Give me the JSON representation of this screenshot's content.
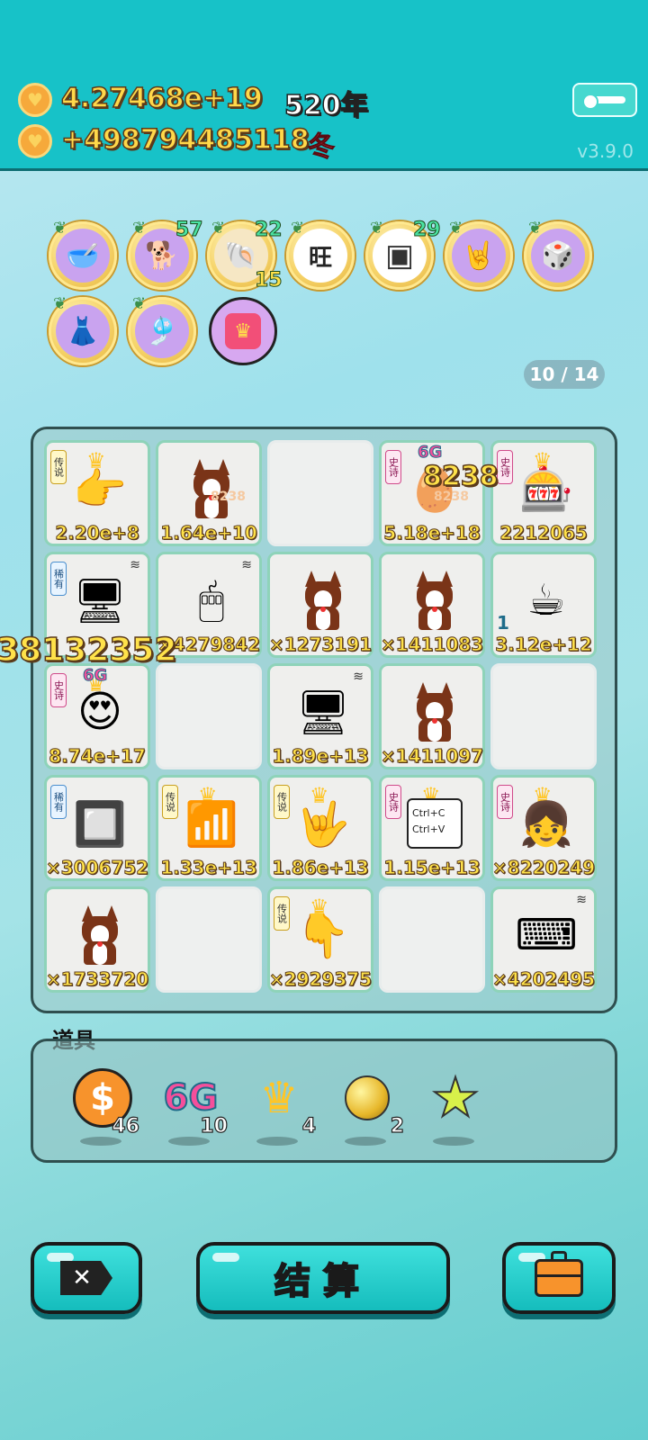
{
  "header": {
    "total_money": "4.27468e+19",
    "income_rate": "+498794485118",
    "year": "520年",
    "season": "冬",
    "version": "v3.9.0"
  },
  "badges": [
    {
      "name": "food-bowl",
      "glyph": "🥣",
      "count": ""
    },
    {
      "name": "shiba-dog",
      "glyph": "🐕",
      "count": "57"
    },
    {
      "name": "shell",
      "glyph": "🐚",
      "count": "22",
      "sub": "15"
    },
    {
      "name": "wang-text",
      "glyph": "旺",
      "count": ""
    },
    {
      "name": "chip-xo",
      "glyph": "▣",
      "count": "29"
    },
    {
      "name": "rock-hand",
      "glyph": "🤘",
      "count": ""
    },
    {
      "name": "dice-head",
      "glyph": "🎲",
      "count": ""
    },
    {
      "name": "skirt",
      "glyph": "👗",
      "count": ""
    },
    {
      "name": "claw-machine",
      "glyph": "🎐",
      "count": ""
    },
    {
      "name": "locked-item",
      "glyph": "🔲",
      "count": ""
    }
  ],
  "pager": "10 / 14",
  "board": {
    "cells": [
      {
        "type": "hand-point",
        "tag": "传说",
        "tag_color": "yellow",
        "crown": true,
        "value": "2.20e+8"
      },
      {
        "type": "dog",
        "value": "1.64e+10",
        "float": "8238"
      },
      {
        "type": "empty"
      },
      {
        "type": "egg-head",
        "tag": "史诗",
        "tag_color": "pink",
        "g6": "6G",
        "value": "5.18e+18",
        "float": "8238"
      },
      {
        "type": "claw-machine",
        "tag": "史诗",
        "tag_color": "pink",
        "crown": true,
        "value": "2212065"
      },
      {
        "type": "pc-tower",
        "tag": "稀有",
        "tag_color": "blue",
        "wifi": true,
        "value": ""
      },
      {
        "type": "mouse",
        "wifi": true,
        "value": "×4279842"
      },
      {
        "type": "dog",
        "value": "×1273191"
      },
      {
        "type": "dog",
        "value": "×1411083"
      },
      {
        "type": "coffee",
        "value": "3.12e+12",
        "side": "1"
      },
      {
        "type": "girl-hearts",
        "tag": "史诗",
        "tag_color": "pink",
        "g6": "6G",
        "crown": true,
        "value": "8.74e+17"
      },
      {
        "type": "empty"
      },
      {
        "type": "monitor",
        "wifi": true,
        "value": "1.89e+13"
      },
      {
        "type": "dog",
        "value": "×1411097"
      },
      {
        "type": "empty"
      },
      {
        "type": "cpu",
        "tag": "稀有",
        "tag_color": "blue",
        "value": "×3006752"
      },
      {
        "type": "wifi-big",
        "tag": "传说",
        "tag_color": "yellow",
        "crown": true,
        "value": "1.33e+13"
      },
      {
        "type": "hand-rock",
        "tag": "传说",
        "tag_color": "yellow",
        "crown": true,
        "value": "1.86e+13"
      },
      {
        "type": "ctrl-cv",
        "tag": "史诗",
        "tag_color": "pink",
        "crown": true,
        "value": "1.15e+13",
        "ctrl1": "Ctrl+C",
        "ctrl2": "Ctrl+V"
      },
      {
        "type": "girl-braids",
        "tag": "史诗",
        "tag_color": "pink",
        "crown": true,
        "value": "×8220249"
      },
      {
        "type": "dog",
        "value": "×1733720"
      },
      {
        "type": "empty"
      },
      {
        "type": "hand-down",
        "tag": "传说",
        "tag_color": "yellow",
        "crown": true,
        "value": "×2929375"
      },
      {
        "type": "empty"
      },
      {
        "type": "keyboard",
        "wifi": true,
        "value": "×4202495"
      }
    ],
    "floaters": {
      "big_left": "38132352",
      "center_top": "8238"
    }
  },
  "items": {
    "label": "道具",
    "list": [
      {
        "name": "dollar-coin",
        "count": "46"
      },
      {
        "name": "6g-boost",
        "text": "6G",
        "count": "10"
      },
      {
        "name": "crown",
        "count": "4"
      },
      {
        "name": "gold-ball",
        "count": "2"
      },
      {
        "name": "star",
        "count": ""
      }
    ]
  },
  "buttons": {
    "settle_label": "结算"
  },
  "colors": {
    "topbar": "#17c2c8",
    "gold": "#ffe24a",
    "cell_border": "#8ed3b9"
  }
}
